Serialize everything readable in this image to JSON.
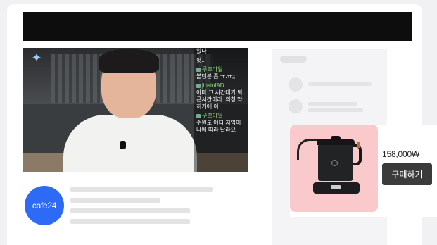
{
  "video": {
    "chat": [
      {
        "user": "",
        "text": "있나"
      },
      {
        "user": "",
        "text": "헛.."
      },
      {
        "user": "무끄마일",
        "text": "볼팅분 좀 ㅠ.ㅠ;;"
      },
      {
        "user": "jinsinfAD",
        "text": "아마 그 시간대가 퇴근시간이라..의청 막히거에 이.."
      },
      {
        "user": "무끄마일",
        "text": "수원도 어디 지역이냐에 따라 달라요"
      }
    ]
  },
  "channel": {
    "logo_text": "cafe24"
  },
  "product": {
    "price": "158,000₩",
    "buy_label": "구매하기"
  },
  "colors": {
    "accent": "#2d6bf6",
    "product_bg": "#f9c9cc",
    "button_bg": "#3b3b3b"
  }
}
